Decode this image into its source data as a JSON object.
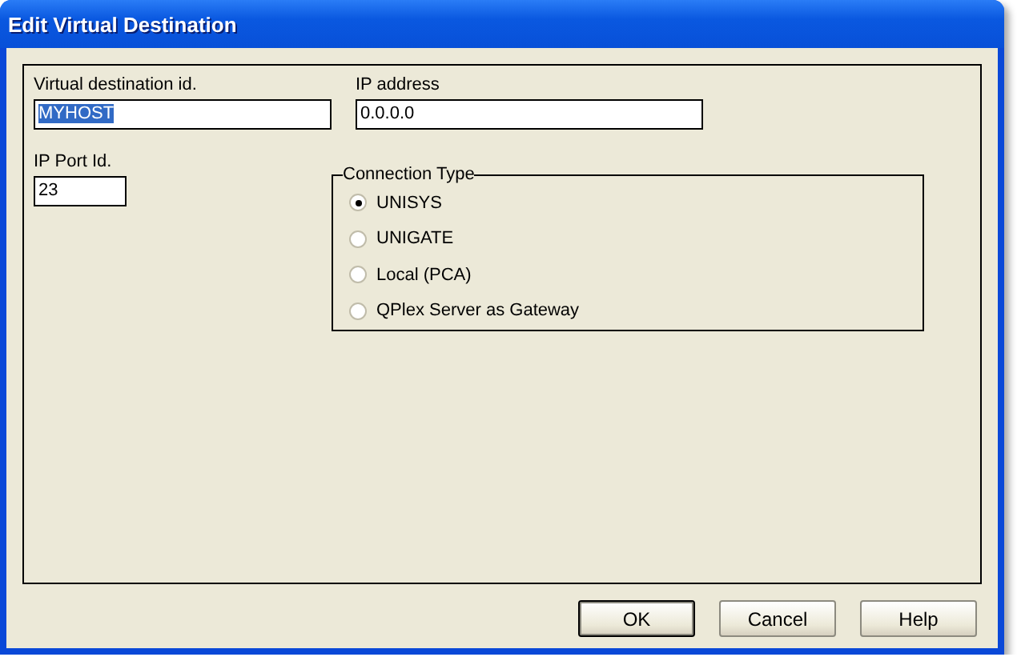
{
  "window": {
    "title": "Edit Virtual Destination"
  },
  "fields": [
    {
      "label": "Virtual destination id.",
      "value": "MYHOST",
      "text_selected": true
    },
    {
      "label": "IP address",
      "value": "0.0.0.0",
      "text_selected": false
    },
    {
      "label": "IP Port Id.",
      "value": "23",
      "text_selected": false
    }
  ],
  "connection_type": {
    "title": "Connection Type",
    "options": [
      {
        "label": "UNISYS",
        "selected": true
      },
      {
        "label": "UNIGATE",
        "selected": false
      },
      {
        "label": "Local (PCA)",
        "selected": false
      },
      {
        "label": "QPlex Server as Gateway",
        "selected": false
      }
    ]
  },
  "buttons": [
    {
      "label": "OK",
      "default": true
    },
    {
      "label": "Cancel",
      "default": false
    },
    {
      "label": "Help",
      "default": false
    }
  ]
}
